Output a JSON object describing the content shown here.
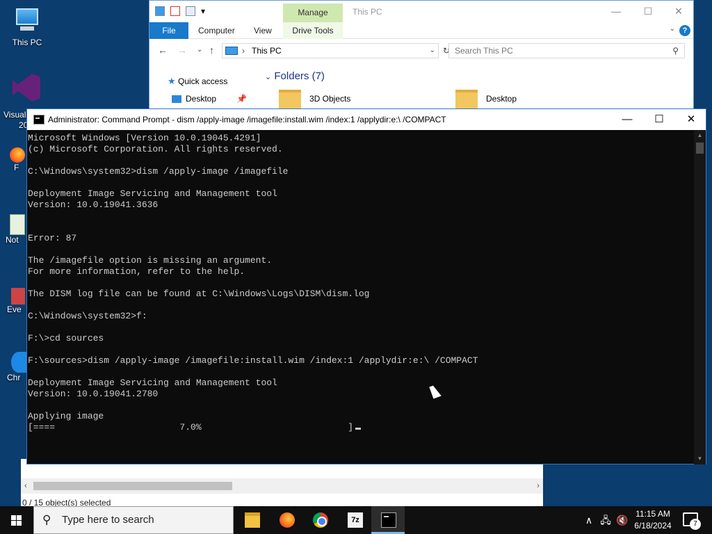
{
  "desktop": {
    "icons": [
      {
        "label": "This PC",
        "icon": "this-pc-icon"
      },
      {
        "label": "Visual",
        "sub": "20",
        "icon": "visual-studio-icon"
      },
      {
        "label": "F",
        "icon": "firefox-icon"
      },
      {
        "label": "Not",
        "icon": "notepad-icon"
      },
      {
        "label": "Eve",
        "icon": "event-viewer-icon"
      },
      {
        "label": "Chr",
        "icon": "chrome-icon"
      }
    ]
  },
  "explorer": {
    "title": "This PC",
    "context_tab": "Manage",
    "tabs": {
      "file": "File",
      "computer": "Computer",
      "view": "View",
      "drive_tools": "Drive Tools"
    },
    "address": {
      "path": "This PC"
    },
    "search": {
      "placeholder": "Search This PC"
    },
    "nav": {
      "quick_access": "Quick access",
      "desktop": "Desktop"
    },
    "folders_header": "Folders (7)",
    "folders": [
      "3D Objects",
      "Desktop"
    ],
    "status": "0 / 15 object(s) selected"
  },
  "cmd": {
    "title": "Administrator: Command Prompt - dism  /apply-image /imagefile:install.wim /index:1 /applydir:e:\\ /COMPACT",
    "lines": [
      "Microsoft Windows [Version 10.0.19045.4291]",
      "(c) Microsoft Corporation. All rights reserved.",
      "",
      "C:\\Windows\\system32>dism /apply-image /imagefile",
      "",
      "Deployment Image Servicing and Management tool",
      "Version: 10.0.19041.3636",
      "",
      "",
      "Error: 87",
      "",
      "The /imagefile option is missing an argument.",
      "For more information, refer to the help.",
      "",
      "The DISM log file can be found at C:\\Windows\\Logs\\DISM\\dism.log",
      "",
      "C:\\Windows\\system32>f:",
      "",
      "F:\\>cd sources",
      "",
      "F:\\sources>dism /apply-image /imagefile:install.wim /index:1 /applydir:e:\\ /COMPACT",
      "",
      "Deployment Image Servicing and Management tool",
      "Version: 10.0.19041.2780",
      "",
      "Applying image"
    ],
    "progress_line": "[====                       7.0%                           ]",
    "progress_percent": 7.0
  },
  "taskbar": {
    "search_placeholder": "Type here to search",
    "apps": [
      "file-explorer",
      "firefox",
      "chrome",
      "7-zip",
      "command-prompt"
    ],
    "time": "11:15 AM",
    "date": "6/18/2024",
    "notification_count": "7"
  }
}
